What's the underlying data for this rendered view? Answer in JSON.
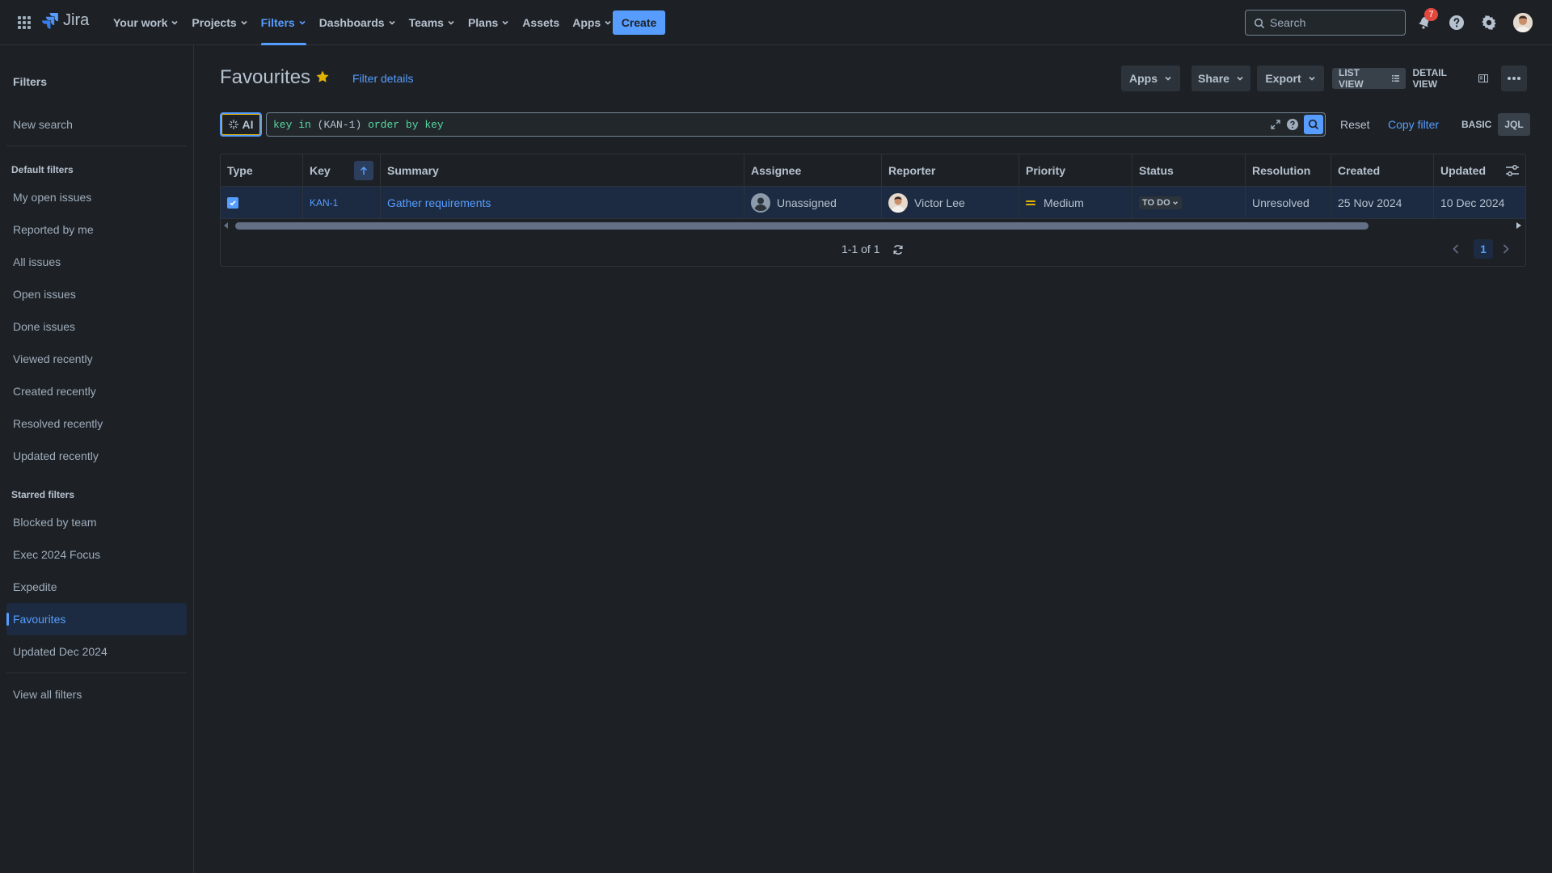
{
  "app": {
    "name": "Jira"
  },
  "topnav": {
    "items": [
      {
        "label": "Your work",
        "has_menu": true
      },
      {
        "label": "Projects",
        "has_menu": true
      },
      {
        "label": "Filters",
        "has_menu": true,
        "active": true
      },
      {
        "label": "Dashboards",
        "has_menu": true
      },
      {
        "label": "Teams",
        "has_menu": true
      },
      {
        "label": "Plans",
        "has_menu": true
      },
      {
        "label": "Assets",
        "has_menu": false
      },
      {
        "label": "Apps",
        "has_menu": true
      }
    ],
    "create_label": "Create",
    "search_placeholder": "Search",
    "notification_count": "7",
    "accent_color": "#579dff"
  },
  "sidebar": {
    "heading": "Filters",
    "new_search": "New search",
    "default_filters_heading": "Default filters",
    "default_filters": [
      "My open issues",
      "Reported by me",
      "All issues",
      "Open issues",
      "Done issues",
      "Viewed recently",
      "Created recently",
      "Resolved recently",
      "Updated recently"
    ],
    "starred_filters_heading": "Starred filters",
    "starred_filters": [
      "Blocked by team",
      "Exec 2024 Focus",
      "Expedite",
      "Favourites",
      "Updated Dec 2024"
    ],
    "active_item": "Favourites",
    "view_all": "View all filters"
  },
  "header": {
    "title": "Favourites",
    "filter_details": "Filter details",
    "apps_label": "Apps",
    "share_label": "Share",
    "export_label": "Export",
    "list_view_label": "LIST VIEW",
    "detail_view_label": "DETAIL VIEW"
  },
  "query": {
    "ai_label": "AI",
    "jql_keyword_key": "key",
    "jql_keyword_in": "in",
    "jql_value": "(KAN-1)",
    "jql_keyword_order": "order",
    "jql_keyword_by": "by",
    "jql_order_field": "key",
    "reset_label": "Reset",
    "copy_filter_label": "Copy filter",
    "basic_label": "BASIC",
    "jql_label": "JQL"
  },
  "table": {
    "columns": [
      "Type",
      "Key",
      "Summary",
      "Assignee",
      "Reporter",
      "Priority",
      "Status",
      "Resolution",
      "Created",
      "Updated"
    ],
    "rows": [
      {
        "key": "KAN-1",
        "summary": "Gather requirements",
        "assignee": "Unassigned",
        "reporter": "Victor Lee",
        "priority": "Medium",
        "status": "TO DO",
        "resolution": "Unresolved",
        "created": "25 Nov 2024",
        "updated": "10 Dec 2024"
      }
    ],
    "pagination_info": "1-1 of 1",
    "current_page": "1"
  }
}
